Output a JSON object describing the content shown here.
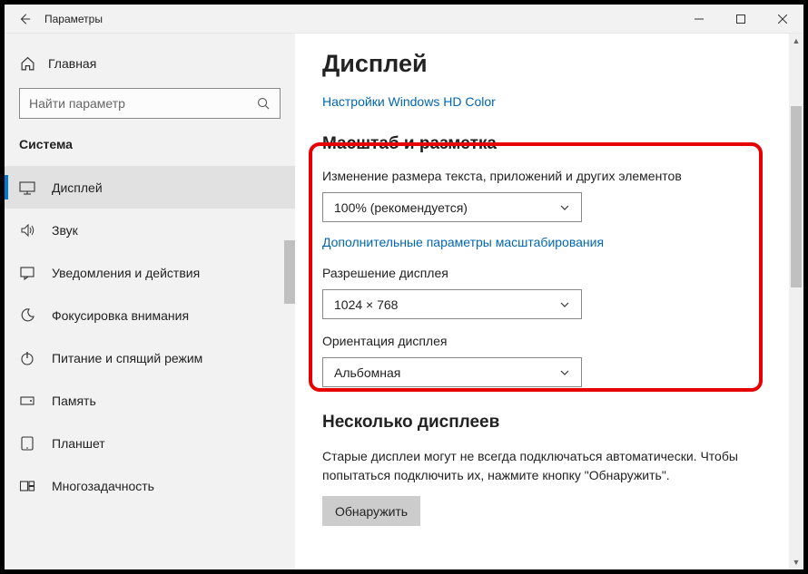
{
  "window": {
    "title": "Параметры"
  },
  "sidebar": {
    "home": "Главная",
    "search_placeholder": "Найти параметр",
    "category": "Система",
    "items": [
      {
        "label": "Дисплей",
        "icon": "display-icon"
      },
      {
        "label": "Звук",
        "icon": "sound-icon"
      },
      {
        "label": "Уведомления и действия",
        "icon": "notifications-icon"
      },
      {
        "label": "Фокусировка внимания",
        "icon": "focus-icon"
      },
      {
        "label": "Питание и спящий режим",
        "icon": "power-icon"
      },
      {
        "label": "Память",
        "icon": "storage-icon"
      },
      {
        "label": "Планшет",
        "icon": "tablet-icon"
      },
      {
        "label": "Многозадачность",
        "icon": "multitasking-icon"
      }
    ]
  },
  "content": {
    "page_title": "Дисплей",
    "hd_color_link": "Настройки Windows HD Color",
    "scale_section": "Масштаб и разметка",
    "scale_label": "Изменение размера текста, приложений и других элементов",
    "scale_value": "100% (рекомендуется)",
    "advanced_scale_link": "Дополнительные параметры масштабирования",
    "resolution_label": "Разрешение дисплея",
    "resolution_value": "1024 × 768",
    "orientation_label": "Ориентация дисплея",
    "orientation_value": "Альбомная",
    "multi_section": "Несколько дисплеев",
    "multi_desc": "Старые дисплеи могут не всегда подключаться автоматически. Чтобы попытаться подключить их, нажмите кнопку \"Обнаружить\".",
    "detect_btn": "Обнаружить"
  }
}
